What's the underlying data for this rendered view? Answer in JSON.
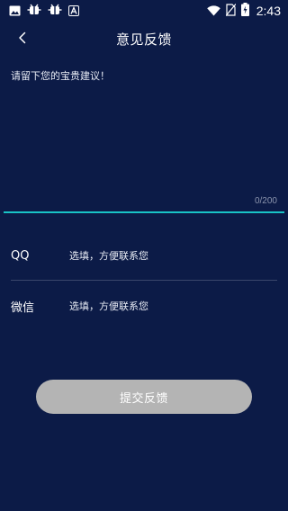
{
  "status_bar": {
    "time": "2:43",
    "left_icons": [
      "image-icon",
      "bug-icon",
      "bug-icon",
      "font-a-icon"
    ],
    "right_icons": [
      "wifi-icon",
      "no-sim-icon",
      "battery-charging-icon"
    ]
  },
  "header": {
    "title": "意见反馈",
    "back_icon": "chevron-left-icon"
  },
  "feedback": {
    "placeholder": "请留下您的宝贵建议！",
    "value": "",
    "counter": "0/200"
  },
  "form": {
    "qq": {
      "label": "QQ",
      "placeholder": "选填，方便联系您"
    },
    "wechat": {
      "label": "微信",
      "placeholder": "选填，方便联系您"
    }
  },
  "submit": {
    "label": "提交反馈"
  },
  "colors": {
    "background": "#0c1b47",
    "accent": "#19c3c6",
    "button_disabled": "#b4b4b4",
    "counter_text": "#8a93ac"
  }
}
